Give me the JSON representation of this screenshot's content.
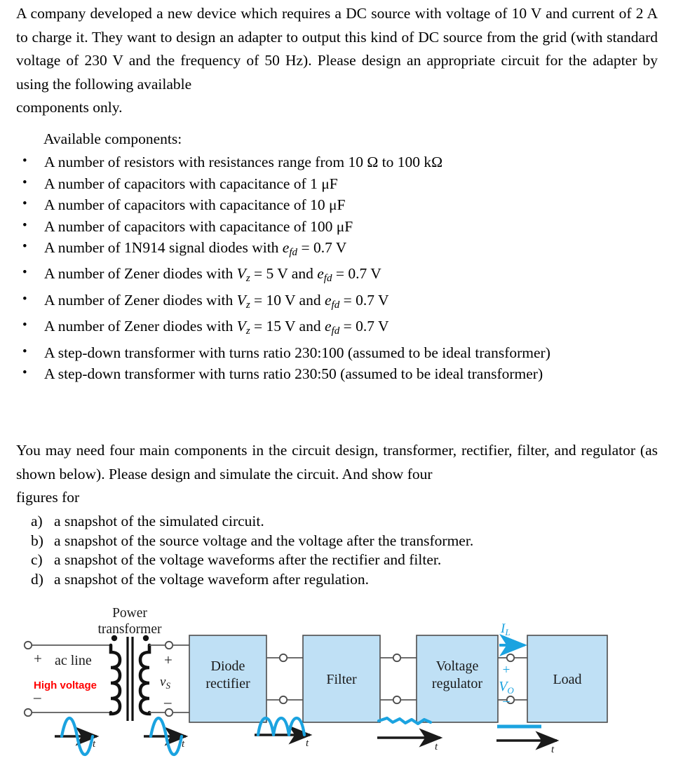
{
  "document": {
    "intro_paragraph": "A company developed a new device which requires a DC source with voltage of 10 V and current of 2 A to charge it. They want to design an adapter to output this kind of DC source from the grid (with standard voltage of 230 V and the frequency of 50 Hz). Please design an appropriate circuit for the adapter by using the following available",
    "intro_last_line": "components only.",
    "available_heading": "Available components:",
    "components": [
      "A number of resistors with resistances range from 10 Ω to 100 kΩ",
      "A number of capacitors with capacitance of 1 μF",
      "A number of capacitors with capacitance of 10 μF",
      "A number of capacitors with capacitance of 100 μF",
      "A number of 1N914 signal diodes with e_fd = 0.7 V",
      "A number of Zener diodes with V_z = 5 V and e_fd = 0.7 V",
      "A number of Zener diodes with V_z = 10 V and e_fd = 0.7 V",
      "A number of Zener diodes with V_z = 15 V and e_fd = 0.7 V",
      "A step-down transformer with turns ratio 230:100 (assumed to be ideal transformer)",
      "A step-down transformer with turns ratio 230:50 (assumed to be ideal transformer)"
    ],
    "components_parts": [
      {
        "pre": "A number of resistors with resistances range from 10 Ω to 100 kΩ"
      },
      {
        "pre": "A number of capacitors with capacitance of 1 μF"
      },
      {
        "pre": "A number of capacitors with capacitance of 10 μF"
      },
      {
        "pre": "A number of capacitors with capacitance of 100 μF"
      },
      {
        "pre": "A number of 1N914 signal diodes with ",
        "sym1": "e",
        "sub1": "fd",
        "mid": " = 0.7 V"
      },
      {
        "pre": "A number of Zener diodes with ",
        "sym1": "V",
        "sub1": "z",
        "mid": " = 5 V and ",
        "sym2": "e",
        "sub2": "fd",
        "post": " = 0.7 V"
      },
      {
        "pre": "A number of Zener diodes with ",
        "sym1": "V",
        "sub1": "z",
        "mid": " = 10 V and ",
        "sym2": "e",
        "sub2": "fd",
        "post": " = 0.7 V"
      },
      {
        "pre": "A number of Zener diodes with ",
        "sym1": "V",
        "sub1": "z",
        "mid": " = 15 V and ",
        "sym2": "e",
        "sub2": "fd",
        "post": " = 0.7 V"
      },
      {
        "pre": "A step-down transformer with turns ratio 230:100 (assumed to be ideal transformer)"
      },
      {
        "pre": "A step-down transformer with turns ratio 230:50 (assumed to be ideal transformer)"
      }
    ],
    "second_paragraph": "You may need four main components in the circuit design, transformer, rectifier, filter, and regulator (as shown below). Please design and simulate the circuit. And show four",
    "second_paragraph_last_line": "figures for",
    "sub_questions": [
      {
        "marker": "a)",
        "text": "a snapshot of the simulated circuit."
      },
      {
        "marker": "b)",
        "text": "a snapshot of the source voltage and the voltage after the transformer."
      },
      {
        "marker": "c)",
        "text": "a snapshot  of the voltage waveforms after the rectifier and filter."
      },
      {
        "marker": "d)",
        "text": "a snapshot  of the voltage waveform after regulation."
      }
    ]
  },
  "diagram": {
    "title_line1": "Power",
    "title_line2": "transformer",
    "ac_line_label": "ac line",
    "high_voltage_label": "High voltage",
    "plus_in": "+",
    "minus_in": "–",
    "plus_sec": "+",
    "minus_sec": "–",
    "vs_symbol": "v",
    "vs_sub": "S",
    "blocks": [
      {
        "line1": "Diode",
        "line2": "rectifier"
      },
      {
        "line1": "Filter",
        "line2": ""
      },
      {
        "line1": "Voltage",
        "line2": "regulator"
      },
      {
        "line1": "Load",
        "line2": ""
      }
    ],
    "il_symbol": "I",
    "il_sub": "L",
    "vo_symbol": "V",
    "vo_sub": "O",
    "vo_plus": "+",
    "vo_minus": "–",
    "waveform_axis_labels": [
      "t",
      "t",
      "t",
      "t",
      "t"
    ],
    "waveforms": [
      {
        "name": "ac-line-sine"
      },
      {
        "name": "transformer-sine"
      },
      {
        "name": "rectified-humps"
      },
      {
        "name": "filtered-ripple"
      },
      {
        "name": "regulated-dc"
      }
    ],
    "colors": {
      "block_fill": "#bfe0f5",
      "block_stroke": "#4d4d4d",
      "accent_cyan": "#1ba3e0",
      "high_voltage_red": "#ff0000",
      "wire": "#595959"
    }
  }
}
